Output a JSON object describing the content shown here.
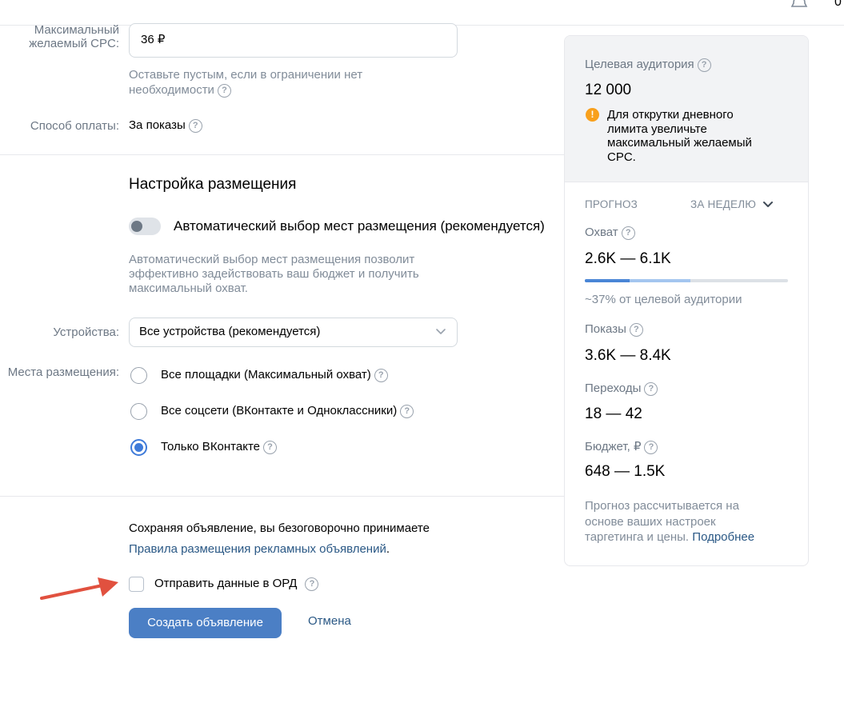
{
  "topbar": {
    "notification_count": "0"
  },
  "cpc": {
    "label_line1": "Максимальный",
    "label_line2": "желаемый CPC:",
    "value": "36 ₽",
    "hint_line1": "Оставьте пустым, если в ограничении нет",
    "hint_line2": "необходимости"
  },
  "payment": {
    "label": "Способ оплаты:",
    "value": "За показы"
  },
  "placement": {
    "title": "Настройка размещения",
    "auto_label": "Автоматический выбор мест размещения (рекомендуется)",
    "auto_enabled": false,
    "auto_hint_line1": "Автоматический выбор мест размещения позволит",
    "auto_hint_line2": "эффективно задействовать ваш бюджет и получить",
    "auto_hint_line3": "максимальный охват.",
    "devices_label": "Устройства:",
    "devices_value": "Все устройства (рекомендуется)",
    "places_label": "Места размещения:",
    "options": [
      {
        "label": "Все площадки (Максимальный охват)",
        "selected": false
      },
      {
        "label": "Все соцсети (ВКонтакте и Одноклассники)",
        "selected": false
      },
      {
        "label": "Только ВКонтакте",
        "selected": true
      }
    ]
  },
  "footer": {
    "agreement_text": "Сохраняя объявление, вы безоговорочно принимаете",
    "rules_link": "Правила размещения рекламных объявлений",
    "rules_dot": ".",
    "ord_label": "Отправить данные в ОРД",
    "ord_checked": false,
    "create_button": "Создать объявление",
    "cancel_button": "Отмена"
  },
  "panel": {
    "audience_label": "Целевая аудитория",
    "audience_value": "12 000",
    "warning_line1": "Для открутки дневного",
    "warning_line2": "лимита увеличьте",
    "warning_line3": "максимальный желаемый",
    "warning_line4": "CPC.",
    "forecast_label": "ПРОГНОЗ",
    "period_label": "ЗА НЕДЕЛЮ",
    "reach_label": "Охват",
    "reach_value": "2.6K — 6.1K",
    "reach_bar": {
      "dark_fraction": 0.22,
      "light_fraction": 0.52
    },
    "reach_hint": "~37% от целевой аудитории",
    "impressions_label": "Показы",
    "impressions_value": "3.6K — 8.4K",
    "clicks_label": "Переходы",
    "clicks_value": "18 — 42",
    "budget_label": "Бюджет, ₽",
    "budget_value": "648 — 1.5K",
    "note_line1": "Прогноз рассчитывается на",
    "note_line2": "основе ваших настроек",
    "note_line3": "таргетинга и цены.",
    "note_link": "Подробнее"
  },
  "colors": {
    "primary": "#4b7fc5",
    "link": "#2a5885",
    "warning": "#f8a01c",
    "bar_dark": "#4a86d6",
    "bar_light": "#a4c6ef",
    "arrow": "#e1513f"
  }
}
